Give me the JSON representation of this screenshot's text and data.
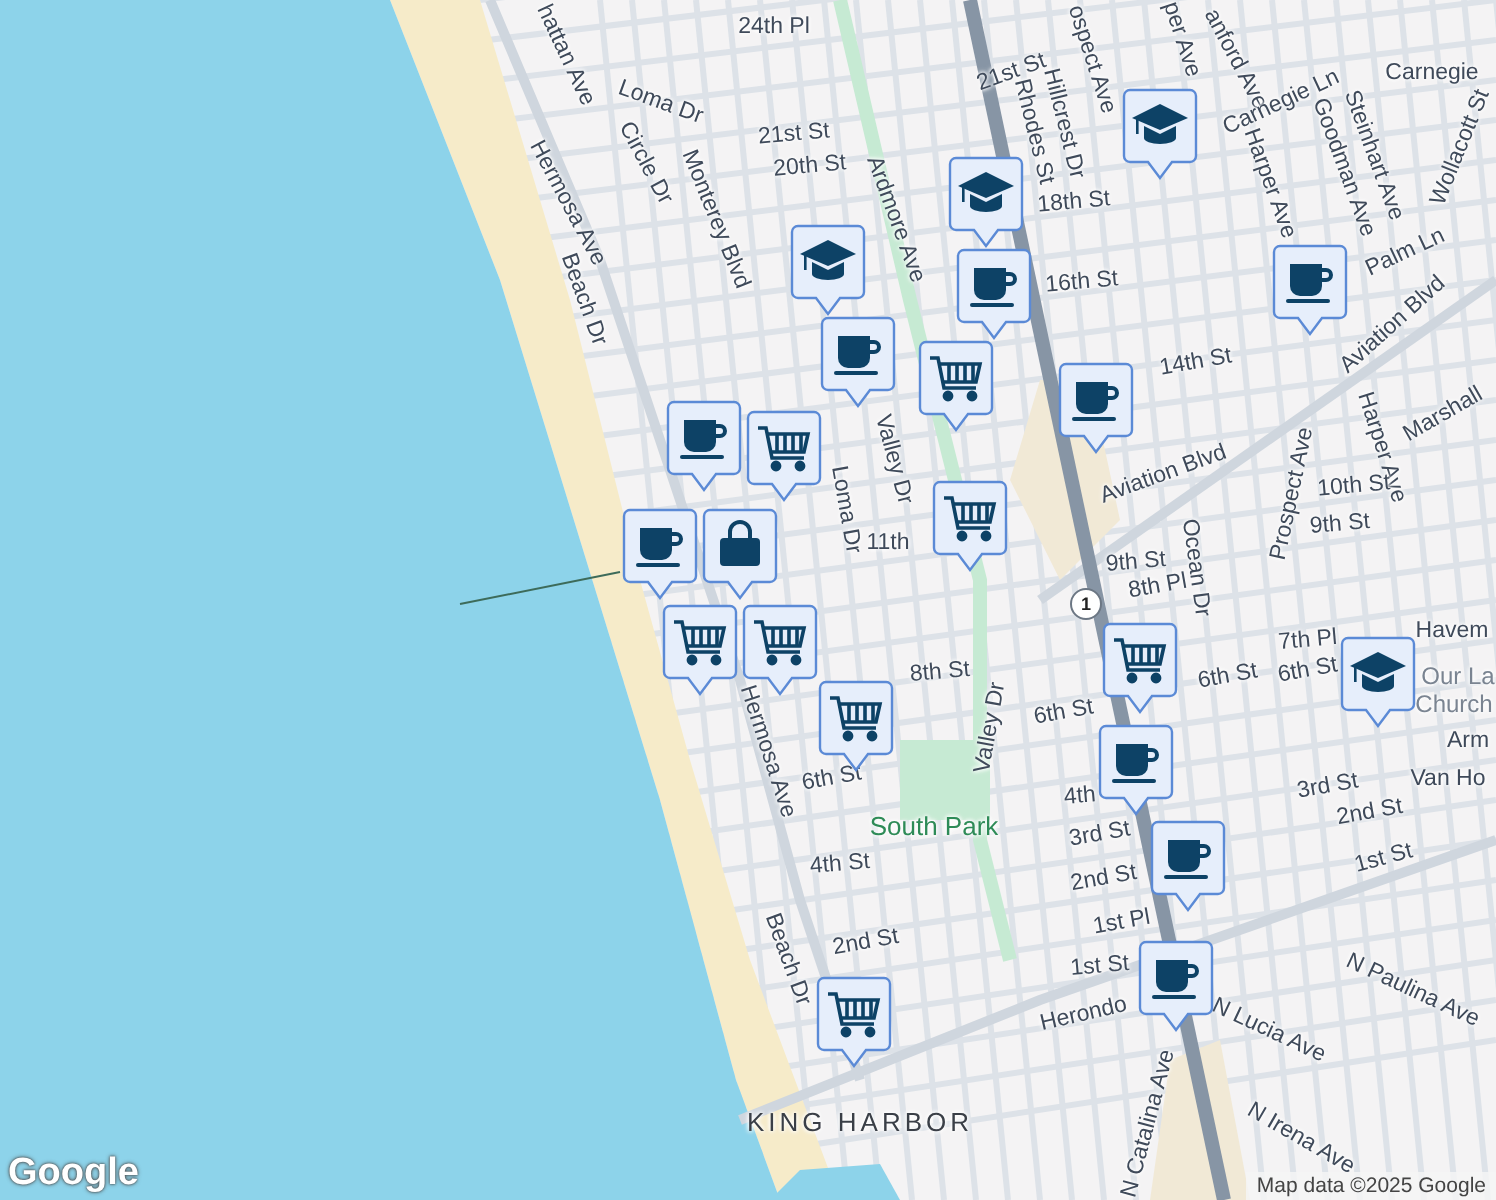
{
  "map": {
    "labels": [
      {
        "text": "24th Pl",
        "kind": "street"
      },
      {
        "text": "hattan Ave",
        "kind": "street"
      },
      {
        "text": "Loma Dr",
        "kind": "street"
      },
      {
        "text": "Circle Dr",
        "kind": "street"
      },
      {
        "text": "Monterey Blvd",
        "kind": "street"
      },
      {
        "text": "21st St",
        "kind": "street"
      },
      {
        "text": "20th St",
        "kind": "street"
      },
      {
        "text": "Hermosa Ave",
        "kind": "street"
      },
      {
        "text": "Beach Dr",
        "kind": "street"
      },
      {
        "text": "Ardmore Ave",
        "kind": "street"
      },
      {
        "text": "Valley Dr",
        "kind": "street"
      },
      {
        "text": "Loma Dr",
        "kind": "street"
      },
      {
        "text": "11th",
        "kind": "street"
      },
      {
        "text": "ospect Ave",
        "kind": "street"
      },
      {
        "text": "21st St",
        "kind": "street"
      },
      {
        "text": "Hillcrest Dr",
        "kind": "street"
      },
      {
        "text": "Rhodes St",
        "kind": "street"
      },
      {
        "text": "18th St",
        "kind": "street"
      },
      {
        "text": "16th St",
        "kind": "street"
      },
      {
        "text": "14th St",
        "kind": "street"
      },
      {
        "text": "per Ave",
        "kind": "street"
      },
      {
        "text": "anford Ave",
        "kind": "street"
      },
      {
        "text": "Carnegie Ln",
        "kind": "street"
      },
      {
        "text": "Harper Ave",
        "kind": "street"
      },
      {
        "text": "Goodman Ave",
        "kind": "street"
      },
      {
        "text": "Steinhart Ave",
        "kind": "street"
      },
      {
        "text": "Palm Ln",
        "kind": "street"
      },
      {
        "text": "Aviation Blvd",
        "kind": "street"
      },
      {
        "text": "Aviation Blvd",
        "kind": "street"
      },
      {
        "text": "Prospect Ave",
        "kind": "street"
      },
      {
        "text": "Harper Ave",
        "kind": "street"
      },
      {
        "text": "Marshall",
        "kind": "street"
      },
      {
        "text": "10th St",
        "kind": "street"
      },
      {
        "text": "9th St",
        "kind": "street"
      },
      {
        "text": "9th St",
        "kind": "street"
      },
      {
        "text": "8th Pl",
        "kind": "street"
      },
      {
        "text": "Ocean Dr",
        "kind": "street"
      },
      {
        "text": "Wollacott St",
        "kind": "street"
      },
      {
        "text": "Carnegie",
        "kind": "street"
      },
      {
        "text": "Havem",
        "kind": "street"
      },
      {
        "text": "7th Pl",
        "kind": "street"
      },
      {
        "text": "6th St",
        "kind": "street"
      },
      {
        "text": "Our La",
        "kind": "poi"
      },
      {
        "text": "Church",
        "kind": "poi"
      },
      {
        "text": "Arm",
        "kind": "street"
      },
      {
        "text": "Van Ho",
        "kind": "street"
      },
      {
        "text": "3rd St",
        "kind": "street"
      },
      {
        "text": "2nd St",
        "kind": "street"
      },
      {
        "text": "1st St",
        "kind": "street"
      },
      {
        "text": "8th St",
        "kind": "street"
      },
      {
        "text": "6th St",
        "kind": "street"
      },
      {
        "text": "6th St",
        "kind": "street"
      },
      {
        "text": "Valley Dr",
        "kind": "street"
      },
      {
        "text": "6th St",
        "kind": "street"
      },
      {
        "text": "South Park",
        "kind": "park"
      },
      {
        "text": "4th St",
        "kind": "street"
      },
      {
        "text": "4th",
        "kind": "street"
      },
      {
        "text": "3rd St",
        "kind": "street"
      },
      {
        "text": "2nd St",
        "kind": "street"
      },
      {
        "text": "1st Pl",
        "kind": "street"
      },
      {
        "text": "1st St",
        "kind": "street"
      },
      {
        "text": "2nd St",
        "kind": "street"
      },
      {
        "text": "Beach Dr",
        "kind": "street"
      },
      {
        "text": "Hermosa Ave",
        "kind": "street"
      },
      {
        "text": "Herondo",
        "kind": "street"
      },
      {
        "text": "N Paulina Ave",
        "kind": "street"
      },
      {
        "text": "N Lucia Ave",
        "kind": "street"
      },
      {
        "text": "N Catalina Ave",
        "kind": "street"
      },
      {
        "text": "N Irena Ave",
        "kind": "street"
      },
      {
        "text": "KING HARBOR",
        "kind": "area"
      }
    ],
    "markers": [
      {
        "kind": "school"
      },
      {
        "kind": "school"
      },
      {
        "kind": "cup"
      },
      {
        "kind": "cart"
      },
      {
        "kind": "school"
      },
      {
        "kind": "cup"
      },
      {
        "kind": "cup"
      },
      {
        "kind": "cup"
      },
      {
        "kind": "cup"
      },
      {
        "kind": "cart"
      },
      {
        "kind": "cup"
      },
      {
        "kind": "bag"
      },
      {
        "kind": "cart"
      },
      {
        "kind": "cart"
      },
      {
        "kind": "cart"
      },
      {
        "kind": "cart"
      },
      {
        "kind": "cart"
      },
      {
        "kind": "school"
      },
      {
        "kind": "cup"
      },
      {
        "kind": "cup"
      },
      {
        "kind": "cup"
      },
      {
        "kind": "cart"
      }
    ],
    "route_shield": "1"
  },
  "logo": "Google",
  "attribution": "Map data ©2025 Google"
}
